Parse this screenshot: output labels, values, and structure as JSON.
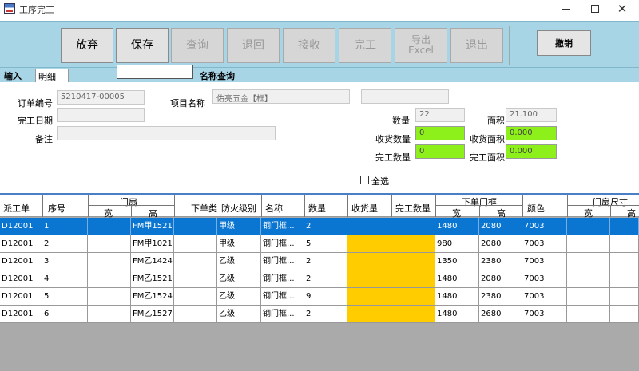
{
  "window": {
    "title": "工序完工",
    "min_glyph": "—",
    "close_glyph": "✕",
    "app_icon": "app-icon"
  },
  "toolbar": {
    "buttons": [
      {
        "label": "放弃",
        "enabled": true
      },
      {
        "label": "保存",
        "enabled": true
      },
      {
        "label": "查询",
        "enabled": false
      },
      {
        "label": "退回",
        "enabled": false
      },
      {
        "label": "接收",
        "enabled": false
      },
      {
        "label": "完工",
        "enabled": false
      },
      {
        "label_line1": "导出",
        "label_line2": "Excel",
        "enabled": false
      },
      {
        "label": "退出",
        "enabled": false
      }
    ],
    "cancel_label": "撤销"
  },
  "tabs": {
    "input": "输入",
    "detail": "明细"
  },
  "name_search": {
    "value": "",
    "label": "名称查询"
  },
  "form": {
    "order_no_label": "订单编号",
    "order_no": "5210417-00005",
    "project_name_label": "项目名称",
    "project_name": "佑亮五金【框】",
    "project_extra": "",
    "complete_date_label": "完工日期",
    "complete_date": "",
    "remark_label": "备注",
    "remark": "",
    "qty_label": "数量",
    "qty": "22",
    "area_label": "面积",
    "area": "21.100",
    "recv_qty_label": "收货数量",
    "recv_qty": "0",
    "recv_area_label": "收货面积",
    "recv_area": "0.000",
    "done_qty_label": "完工数量",
    "done_qty": "0",
    "done_area_label": "完工面积",
    "done_area": "0.000",
    "select_all_label": "全选",
    "select_all_checked": false
  },
  "grid": {
    "headers": {
      "dispatch": "派工单",
      "seq": "序号",
      "door_leaf": "门扇",
      "door_leaf_w": "宽",
      "door_leaf_h": "高",
      "order_type": "下单类",
      "fire_level": "防火级别",
      "name": "名称",
      "qty": "数量",
      "recv_qty": "收货量",
      "done_qty": "完工数量",
      "frame": "下单门框",
      "frame_w": "宽",
      "frame_h": "高",
      "color": "颜色",
      "door_size": "门扇尺寸",
      "door_size_w": "宽",
      "door_size_h": "高"
    },
    "rows": [
      {
        "dispatch": "D12001",
        "seq": "1",
        "leaf_w": "",
        "leaf_h": "FM甲1521",
        "type": "",
        "fire": "甲级",
        "name": "钢门框...",
        "qty": "2",
        "recv": "",
        "done": "",
        "frame_w": "1480",
        "frame_h": "2080",
        "color": "7003",
        "size_w": "",
        "size_h": ""
      },
      {
        "dispatch": "D12001",
        "seq": "2",
        "leaf_w": "",
        "leaf_h": "FM甲1021",
        "type": "",
        "fire": "甲级",
        "name": "钢门框...",
        "qty": "5",
        "recv": "",
        "done": "",
        "frame_w": "980",
        "frame_h": "2080",
        "color": "7003",
        "size_w": "",
        "size_h": ""
      },
      {
        "dispatch": "D12001",
        "seq": "3",
        "leaf_w": "",
        "leaf_h": "FM乙1424",
        "type": "",
        "fire": "乙级",
        "name": "钢门框...",
        "qty": "2",
        "recv": "",
        "done": "",
        "frame_w": "1350",
        "frame_h": "2380",
        "color": "7003",
        "size_w": "",
        "size_h": ""
      },
      {
        "dispatch": "D12001",
        "seq": "4",
        "leaf_w": "",
        "leaf_h": "FM乙1521",
        "type": "",
        "fire": "乙级",
        "name": "钢门框...",
        "qty": "2",
        "recv": "",
        "done": "",
        "frame_w": "1480",
        "frame_h": "2080",
        "color": "7003",
        "size_w": "",
        "size_h": ""
      },
      {
        "dispatch": "D12001",
        "seq": "5",
        "leaf_w": "",
        "leaf_h": "FM乙1524",
        "type": "",
        "fire": "乙级",
        "name": "钢门框...",
        "qty": "9",
        "recv": "",
        "done": "",
        "frame_w": "1480",
        "frame_h": "2380",
        "color": "7003",
        "size_w": "",
        "size_h": ""
      },
      {
        "dispatch": "D12001",
        "seq": "6",
        "leaf_w": "",
        "leaf_h": "FM乙1527",
        "type": "",
        "fire": "乙级",
        "name": "钢门框...",
        "qty": "2",
        "recv": "",
        "done": "",
        "frame_w": "1480",
        "frame_h": "2680",
        "color": "7003",
        "size_w": "",
        "size_h": ""
      }
    ],
    "selected_row": 0
  },
  "colors": {
    "toolbar_bg": "#a7d5e5",
    "selected_row": "#0a76d1",
    "highlight_yellow": "#ffcc00",
    "green_field": "#8ef01a"
  }
}
